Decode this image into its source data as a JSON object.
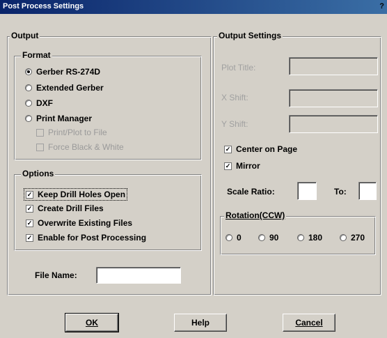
{
  "window": {
    "title": "Post Process Settings",
    "help_glyph": "?"
  },
  "output": {
    "label": "Output",
    "format": {
      "label": "Format",
      "options": [
        {
          "label": "Gerber RS-274D",
          "selected": true
        },
        {
          "label": "Extended Gerber",
          "selected": false
        },
        {
          "label": "DXF",
          "selected": false
        },
        {
          "label": "Print Manager",
          "selected": false
        }
      ],
      "sub_options": [
        {
          "label": "Print/Plot to File",
          "checked": false,
          "enabled": false
        },
        {
          "label": "Force Black & White",
          "checked": false,
          "enabled": false
        }
      ]
    },
    "options": {
      "label": "Options",
      "items": [
        {
          "label": "Keep Drill Holes Open",
          "checked": true
        },
        {
          "label": "Create Drill Files",
          "checked": true
        },
        {
          "label": "Overwrite Existing Files",
          "checked": true
        },
        {
          "label": "Enable for Post Processing",
          "checked": true
        }
      ]
    },
    "file_name": {
      "label": "File Name:",
      "value": ""
    }
  },
  "output_settings": {
    "label": "Output Settings",
    "plot_title": {
      "label": "Plot Title:",
      "value": ""
    },
    "x_shift": {
      "label": "X Shift:",
      "value": ""
    },
    "y_shift": {
      "label": "Y Shift:",
      "value": ""
    },
    "center_on_page": {
      "label": "Center on Page",
      "checked": true
    },
    "mirror": {
      "label": "Mirror",
      "checked": true
    },
    "scale_ratio": {
      "label": "Scale Ratio:",
      "value": "",
      "to_label": "To:",
      "to_value": ""
    },
    "rotation": {
      "label": "Rotation(CCW)",
      "options": [
        {
          "label": "0",
          "selected": false
        },
        {
          "label": "90",
          "selected": false
        },
        {
          "label": "180",
          "selected": false
        },
        {
          "label": "270",
          "selected": false
        }
      ]
    }
  },
  "buttons": {
    "ok": "OK",
    "help": "Help",
    "cancel": "Cancel"
  }
}
